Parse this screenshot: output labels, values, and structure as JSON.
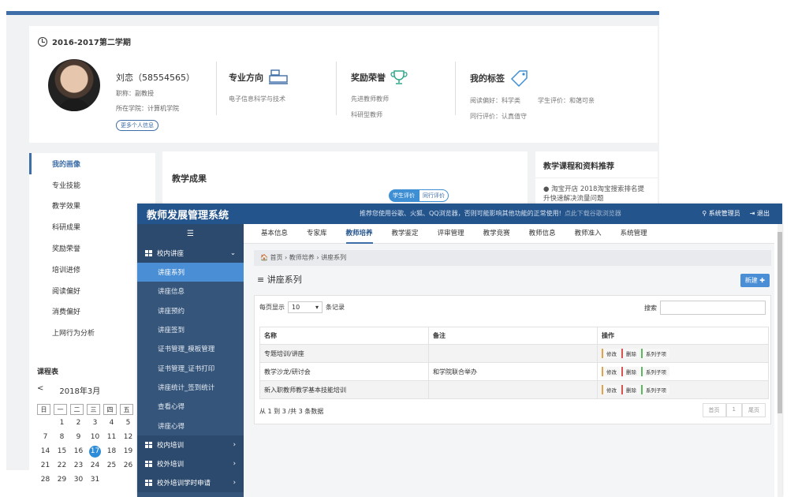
{
  "background": {
    "semester": "2016-2017第二学期",
    "profile": {
      "name": "刘恋（58554565）",
      "title": "职称：副教授",
      "college": "所在学院：计算机学院",
      "more_button": "更多个人信息"
    },
    "direction": {
      "title": "专业方向",
      "value": "电子信息科学与技术"
    },
    "awards": {
      "title": "奖励荣誉",
      "line1": "先进教师教师",
      "line2": "科研型教师"
    },
    "tags": {
      "title": "我的标签",
      "reading": "阅读偏好：科学类",
      "student_eval": "学生评价：和蔼可亲",
      "peer_eval": "同行评价：认真值守"
    },
    "left_nav": [
      "我的画像",
      "专业技能",
      "教学效果",
      "科研成果",
      "奖励荣誉",
      "培训进修",
      "阅读偏好",
      "消费偏好",
      "上网行为分析"
    ],
    "calendar": {
      "title": "课程表",
      "month": "2018年3月",
      "prev": "<",
      "weekdays": [
        "日",
        "一",
        "二",
        "三",
        "四",
        "五"
      ],
      "rows": [
        [
          "",
          "1",
          "2",
          "3",
          "4",
          "5"
        ],
        [
          "7",
          "8",
          "9",
          "10",
          "11",
          "12"
        ],
        [
          "14",
          "15",
          "16",
          "17",
          "18",
          "19"
        ],
        [
          "21",
          "22",
          "23",
          "24",
          "25",
          "26"
        ],
        [
          "28",
          "29",
          "30",
          "31",
          "",
          ""
        ]
      ],
      "today": "17"
    },
    "achievements": {
      "title": "教学成果",
      "tab_student": "学生评价",
      "tab_peer": "同行评价"
    },
    "recommend": {
      "title": "教学课程和资料推荐",
      "item": "● 淘宝开店 2018淘宝搜索排名提升快速解决流量问题"
    }
  },
  "app": {
    "title": "教师发展管理系统",
    "notice": "推荐您使用谷歌、火狐、QQ浏览器，否则可能影响其他功能的正常使用!",
    "notice_link": "点此下载谷歌浏览器",
    "user": "系统管理员",
    "logout": "退出",
    "menu_toggle": "☰",
    "sidebar": {
      "group_open": "校内讲座",
      "items": [
        "讲座系列",
        "讲座信息",
        "讲座预约",
        "讲座签到",
        "证书管理_模板管理",
        "证书管理_证书打印",
        "讲座统计_签到统计",
        "查看心得",
        "讲座心得"
      ],
      "groups_closed": [
        "校内培训",
        "校外培训",
        "校外培训学时申请"
      ]
    },
    "topnav": [
      "基本信息",
      "专家库",
      "教师培养",
      "教学鉴定",
      "评审管理",
      "教学竞赛",
      "教师信息",
      "教师准入",
      "系统管理"
    ],
    "breadcrumb": "🏠 首页 › 教师培养 › 讲座系列",
    "page_title": "≡ 讲座系列",
    "new_button": "新建 ✚",
    "table": {
      "length_prefix": "每页显示",
      "length_value": "10",
      "length_suffix": "条记录",
      "search_label": "搜索",
      "headers": [
        "名称",
        "备注",
        "操作"
      ],
      "rows": [
        {
          "name": "专题培训/讲座",
          "note": ""
        },
        {
          "name": "教学沙龙/研讨会",
          "note": "和学院联合举办"
        },
        {
          "name": "新入职教师教学基本技能培训",
          "note": ""
        }
      ],
      "actions": {
        "edit": "修改",
        "delete": "删除",
        "children": "系列子项"
      },
      "info": "从 1 到 3 /共 3 条数据",
      "pager": [
        "首页",
        "1",
        "尾页"
      ]
    }
  }
}
